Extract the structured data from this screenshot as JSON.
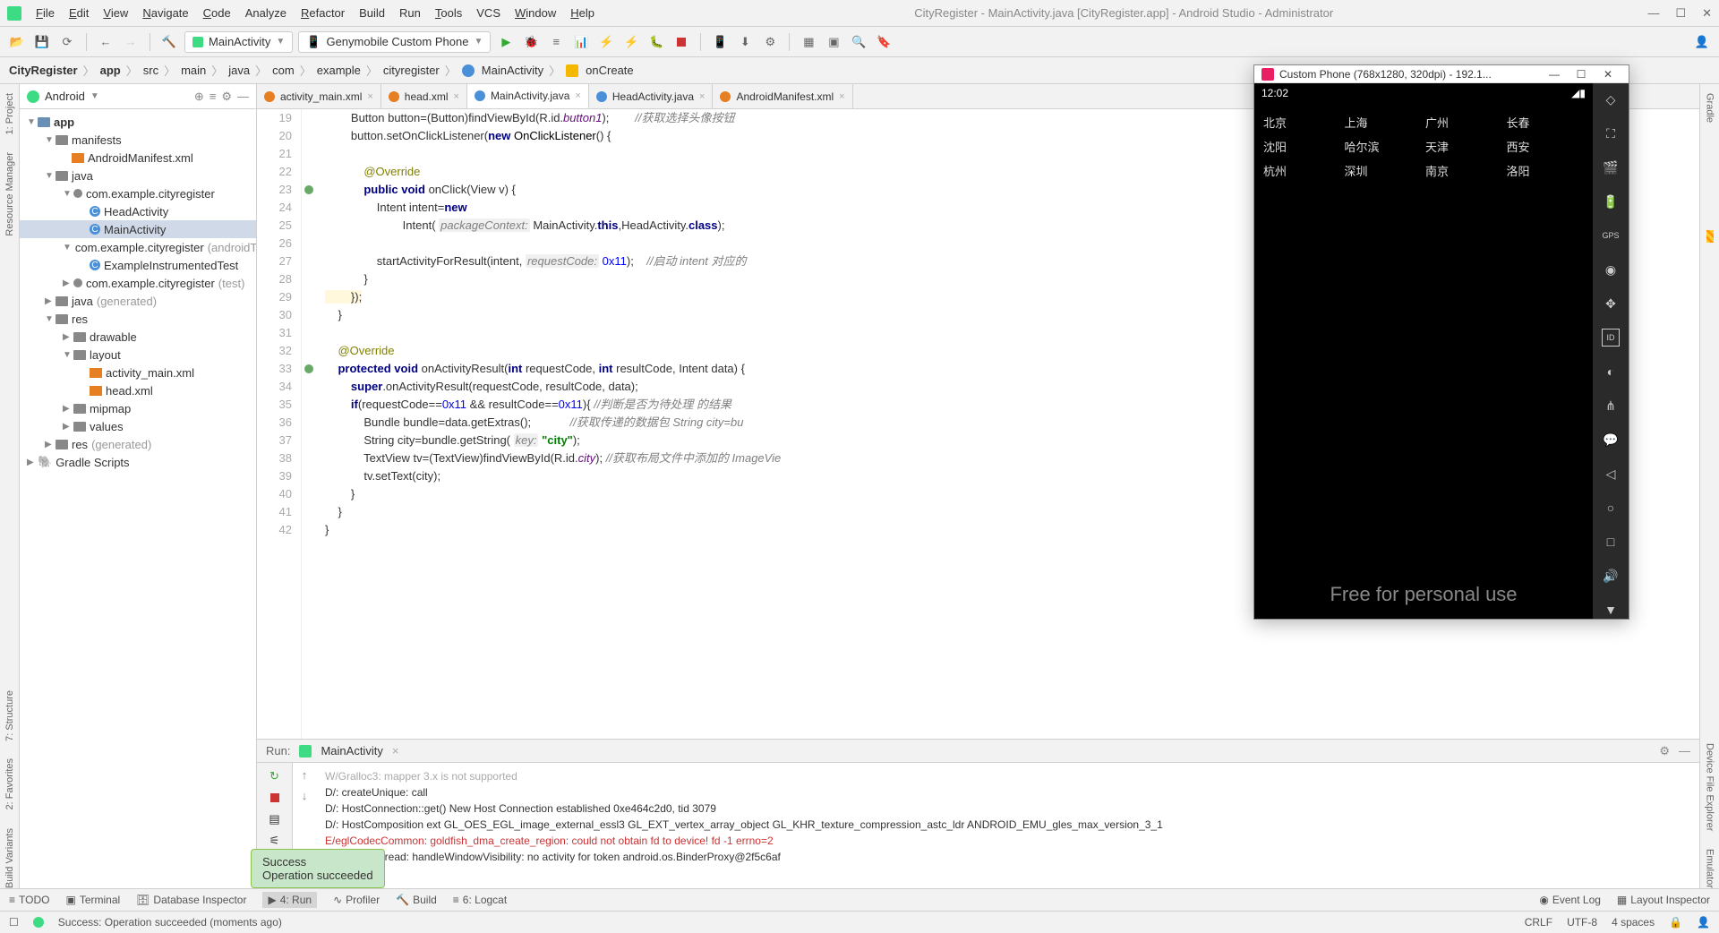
{
  "window": {
    "title": "CityRegister - MainActivity.java [CityRegister.app] - Android Studio - Administrator"
  },
  "menu": {
    "file": "File",
    "edit": "Edit",
    "view": "View",
    "navigate": "Navigate",
    "code": "Code",
    "analyze": "Analyze",
    "refactor": "Refactor",
    "build": "Build",
    "run": "Run",
    "tools": "Tools",
    "vcs": "VCS",
    "window": "Window",
    "help": "Help"
  },
  "toolbar": {
    "config": "MainActivity",
    "device": "Genymobile Custom Phone"
  },
  "breadcrumb": {
    "p0": "CityRegister",
    "p1": "app",
    "p2": "src",
    "p3": "main",
    "p4": "java",
    "p5": "com",
    "p6": "example",
    "p7": "cityregister",
    "p8": "MainActivity",
    "p9": "onCreate"
  },
  "project": {
    "header": "Android",
    "tree": {
      "app": "app",
      "manifests": "manifests",
      "manifest_xml": "AndroidManifest.xml",
      "java": "java",
      "pkg1": "com.example.cityregister",
      "head_activity": "HeadActivity",
      "main_activity": "MainActivity",
      "pkg_android_test": "com.example.cityregister",
      "pkg_android_test_dim": "(androidTest)",
      "example_test": "ExampleInstrumentedTest",
      "pkg_test": "com.example.cityregister",
      "pkg_test_dim": "(test)",
      "java_gen": "java",
      "java_gen_dim": "(generated)",
      "res": "res",
      "drawable": "drawable",
      "layout": "layout",
      "activity_main_xml": "activity_main.xml",
      "head_xml": "head.xml",
      "mipmap": "mipmap",
      "values": "values",
      "res_gen": "res",
      "res_gen_dim": "(generated)",
      "gradle": "Gradle Scripts"
    }
  },
  "tabs": {
    "t0": "activity_main.xml",
    "t1": "head.xml",
    "t2": "MainActivity.java",
    "t3": "HeadActivity.java",
    "t4": "AndroidManifest.xml"
  },
  "code": {
    "l19": "Button button=(Button)findViewById(R.id.button1);        //获取选择头像按钮",
    "l20": "button.setOnClickListener(new OnClickListener() {",
    "l22": "@Override",
    "l23a": "public void",
    "l23b": " onClick(View v) {",
    "l24a": "Intent intent=",
    "l24b": "new",
    "l25a": "Intent( ",
    "l25p": "packageContext:",
    "l25b": " MainActivity.",
    "l25c": "this",
    "l25d": ",HeadActivity.",
    "l25e": "class",
    "l25f": ");",
    "l27a": "startActivityForResult(intent, ",
    "l27p": "requestCode:",
    "l27b": " 0x11);",
    "l27c": "    //启动 intent 对应的",
    "l28": "}",
    "l29": "});",
    "l30": "}",
    "l32": "@Override",
    "l33a": "protected void",
    "l33b": " onActivityResult(",
    "l33c": "int",
    "l33d": " requestCode, ",
    "l33e": "int",
    "l33f": " resultCode, Intent data) {",
    "l34a": "super",
    "l34b": ".onActivityResult(requestCode, resultCode, data);",
    "l35a": "if",
    "l35b": "(requestCode==",
    "l35c": "0x11",
    "l35d": " && resultCode==",
    "l35e": "0x11",
    "l35f": "){ ",
    "l35g": "//判断是否为待处理 的结果",
    "l36a": "Bundle bundle=data.getExtras();",
    "l36b": "            //获取传递的数据包 String city=bu",
    "l37a": "String city=bundle.getString( ",
    "l37p": "key:",
    "l37b": " \"city\");",
    "l38a": "TextView tv=(TextView)findViewById(R.id.",
    "l38b": "city",
    "l38c": "); ",
    "l38d": "//获取布局文件中添加的 ImageVie",
    "l39": "tv.setText(city);",
    "l40": "}",
    "l41": "}",
    "l42": "}"
  },
  "run": {
    "label": "Run:",
    "config": "MainActivity",
    "console": {
      "l0": "W/Gralloc3: mapper 3.x is not supported",
      "l1": "D/: createUnique: call",
      "l2": "D/: HostConnection::get() New Host Connection established 0xe464c2d0, tid 3079",
      "l3": "D/: HostComposition ext GL_OES_EGL_image_external_essl3 GL_EXT_vertex_array_object GL_KHR_texture_compression_astc_ldr ANDROID_EMU_gles_max_version_3_1",
      "l4": "E/eglCodecCommon: goldfish_dma_create_region: could not obtain fd to device! fd -1 errno=2",
      "l5": "W/ActivityThread: handleWindowVisibility: no activity for token android.os.BinderProxy@2f5c6af"
    }
  },
  "toast": {
    "title": "Success",
    "body": "Operation succeeded"
  },
  "bottom_tools": {
    "todo": "TODO",
    "terminal": "Terminal",
    "dbinspector": "Database Inspector",
    "run": "4: Run",
    "profiler": "Profiler",
    "build": "Build",
    "logcat": "6: Logcat",
    "eventlog": "Event Log",
    "layout_inspector": "Layout Inspector"
  },
  "statusbar": {
    "msg": "Success: Operation succeeded (moments ago)",
    "crlf": "CRLF",
    "encoding": "UTF-8",
    "indent": "4 spaces"
  },
  "left_rail": {
    "project": "1: Project",
    "resmgr": "Resource Manager",
    "structure": "7: Structure",
    "favorites": "2: Favorites",
    "bv": "Build Variants"
  },
  "right_rail": {
    "gradle": "Gradle",
    "dfe": "Device File Explorer",
    "emu": "Emulator"
  },
  "emulator": {
    "title": "Custom Phone (768x1280, 320dpi) - 192.1...",
    "clock": "12:02",
    "cities": {
      "r0": [
        "北京",
        "上海",
        "广州",
        "长春"
      ],
      "r1": [
        "沈阳",
        "哈尔滨",
        "天津",
        "西安"
      ],
      "r2": [
        "杭州",
        "深圳",
        "南京",
        "洛阳"
      ]
    },
    "watermark": "Free for personal use"
  }
}
